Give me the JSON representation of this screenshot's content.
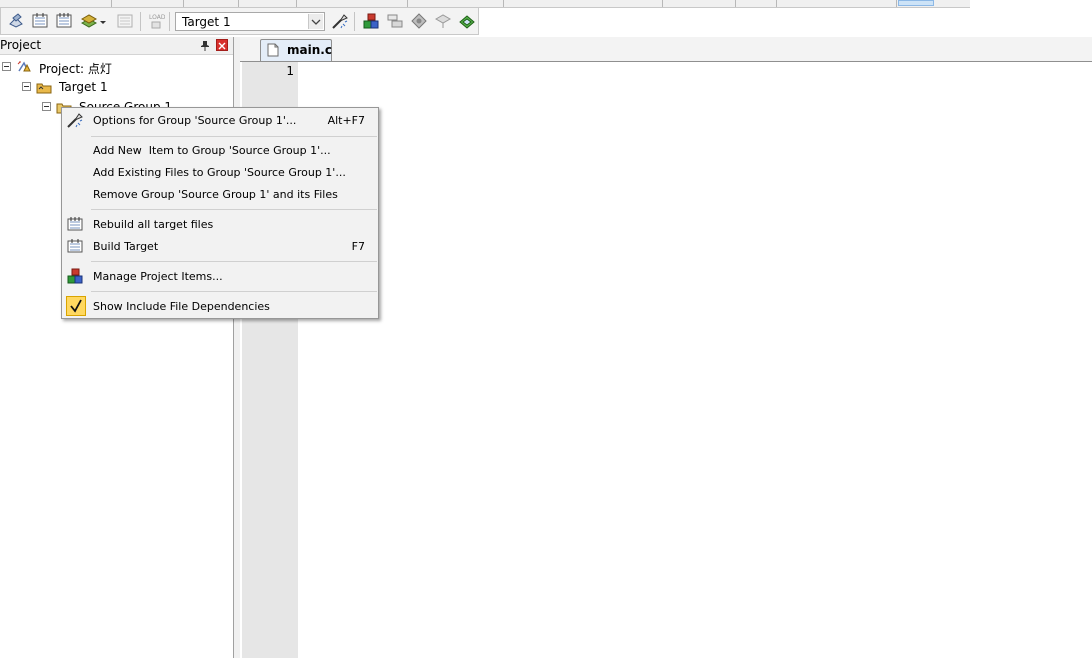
{
  "toolbar": {
    "target_value": "Target 1"
  },
  "project_pane": {
    "title": "Project",
    "tree": [
      {
        "label": "Project: 点灯"
      },
      {
        "label": "Target 1"
      },
      {
        "label": "Source Group 1"
      }
    ]
  },
  "editor": {
    "tab_label": "main.c",
    "line_numbers": [
      "1"
    ]
  },
  "context_menu": {
    "items": [
      {
        "label": "Options for Group 'Source Group 1'...",
        "shortcut": "Alt+F7"
      },
      {
        "label": "Add New  Item to Group 'Source Group 1'..."
      },
      {
        "label": "Add Existing Files to Group 'Source Group 1'..."
      },
      {
        "label": "Remove Group 'Source Group 1' and its Files"
      },
      {
        "label": "Rebuild all target files"
      },
      {
        "label": "Build Target",
        "shortcut": "F7"
      },
      {
        "label": "Manage Project Items..."
      },
      {
        "label": "Show Include File Dependencies",
        "checked": true
      }
    ]
  },
  "colors": {
    "close_button": "#d8302c",
    "gutter": "#e6e6e6",
    "check_highlight": "#ffd860"
  }
}
